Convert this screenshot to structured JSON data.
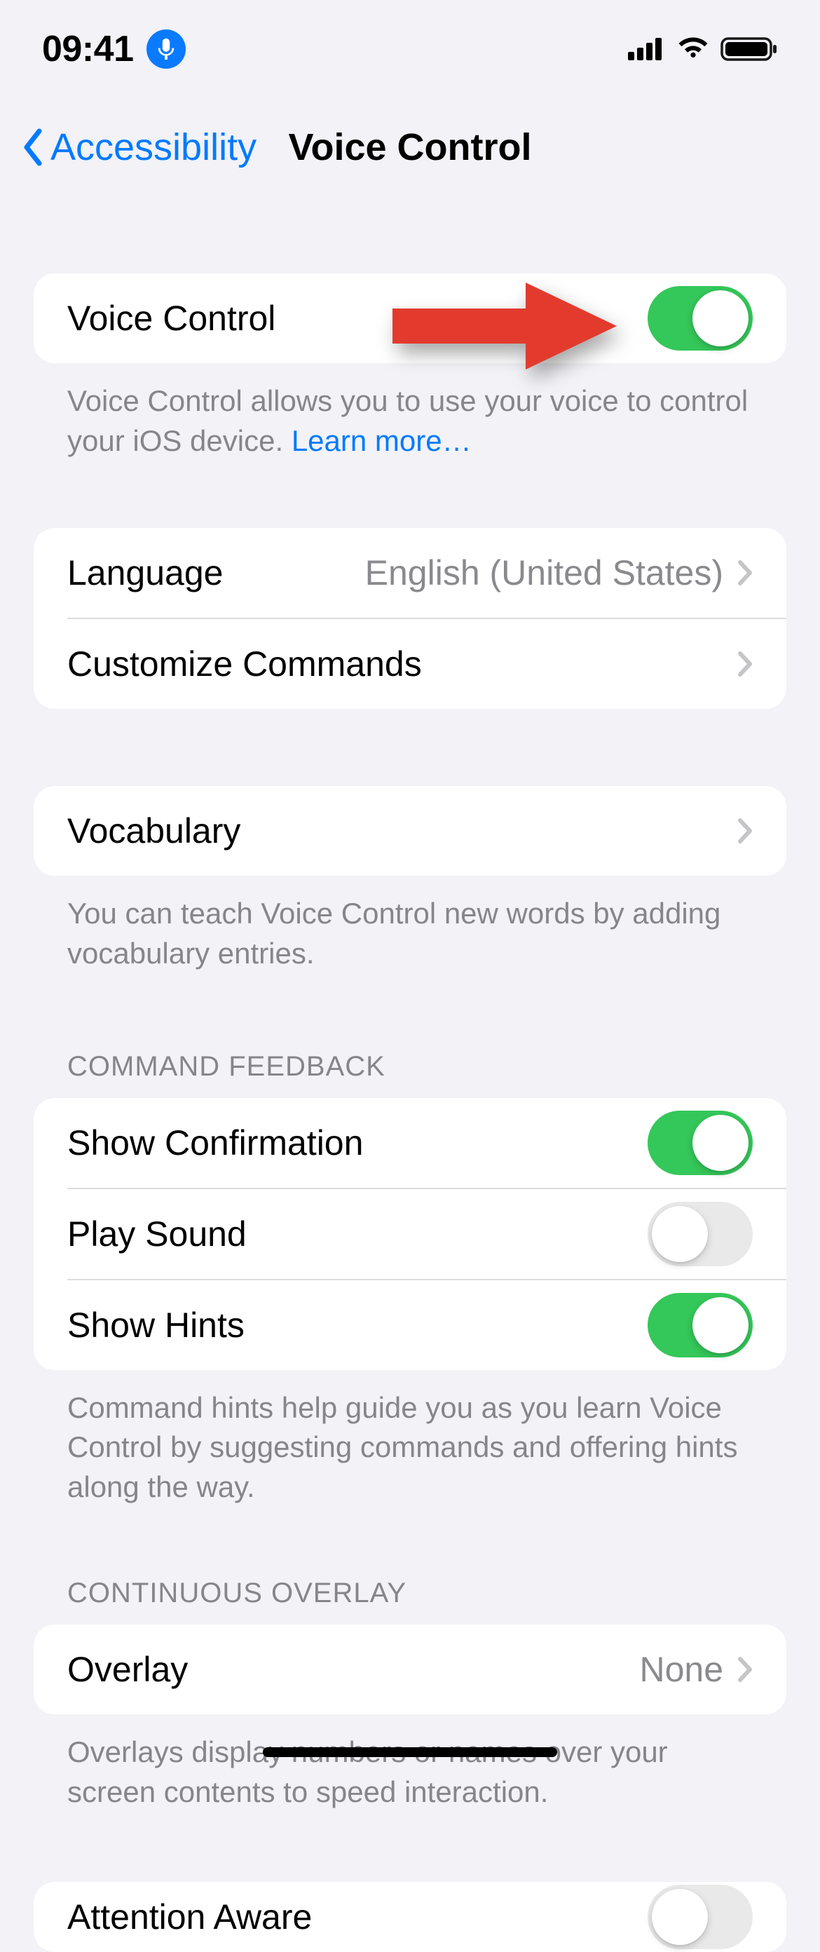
{
  "status": {
    "time": "09:41"
  },
  "nav": {
    "back_label": "Accessibility",
    "title": "Voice Control"
  },
  "voice_control": {
    "label": "Voice Control",
    "enabled": true,
    "footer_pre": "Voice Control allows you to use your voice to control your iOS device. ",
    "learn_more": "Learn more…"
  },
  "language": {
    "label": "Language",
    "value": "English (United States)"
  },
  "customize": {
    "label": "Customize Commands"
  },
  "vocabulary": {
    "label": "Vocabulary",
    "footer": "You can teach Voice Control new words by adding vocabulary entries."
  },
  "command_feedback": {
    "header": "COMMAND FEEDBACK",
    "show_confirmation": {
      "label": "Show Confirmation",
      "enabled": true
    },
    "play_sound": {
      "label": "Play Sound",
      "enabled": false
    },
    "show_hints": {
      "label": "Show Hints",
      "enabled": true
    },
    "footer": "Command hints help guide you as you learn Voice Control by suggesting commands and offering hints along the way."
  },
  "continuous_overlay": {
    "header": "CONTINUOUS OVERLAY",
    "overlay": {
      "label": "Overlay",
      "value": "None"
    },
    "footer": "Overlays display numbers or names over your screen contents to speed interaction."
  },
  "attention_aware": {
    "label": "Attention Aware",
    "enabled": false
  }
}
